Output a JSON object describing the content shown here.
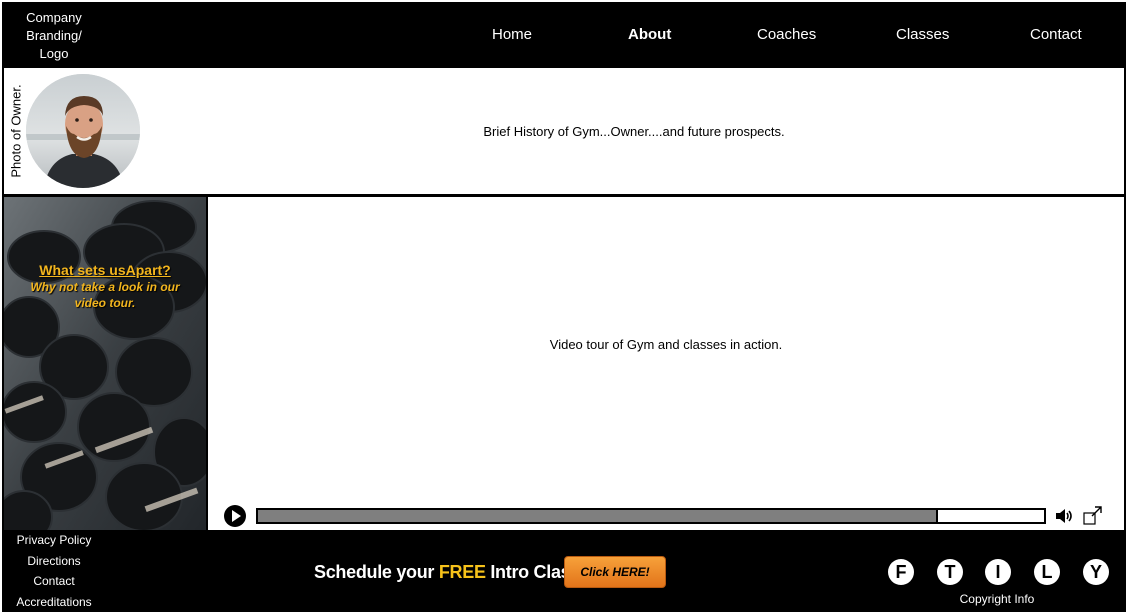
{
  "header": {
    "logo_text": "Company Branding/ Logo",
    "nav": [
      {
        "label": "Home",
        "active": false
      },
      {
        "label": "About",
        "active": true
      },
      {
        "label": "Coaches",
        "active": false
      },
      {
        "label": "Classes",
        "active": false
      },
      {
        "label": "Contact",
        "active": false
      }
    ]
  },
  "owner": {
    "photo_caption": "Photo of Owner.",
    "history_text": "Brief History of Gym...Owner....and future prospects."
  },
  "promo": {
    "title": "What sets usApart?",
    "subtitle": "Why not take a look in our video tour."
  },
  "video": {
    "label": "Video tour of Gym and classes in action.",
    "progress_percent": 86.5
  },
  "footer": {
    "links": [
      "Privacy Policy",
      "Directions",
      "Contact",
      "Accreditations"
    ],
    "schedule_prefix": "Schedule your ",
    "schedule_free": "FREE",
    "schedule_suffix": " Intro Class:",
    "cta_label": "Click HERE!",
    "socials": [
      "F",
      "T",
      "I",
      "L",
      "Y"
    ],
    "copyright": "Copyright Info"
  },
  "colors": {
    "accent": "#f6c21a",
    "cta": "#f08a2a",
    "background": "#000000"
  }
}
